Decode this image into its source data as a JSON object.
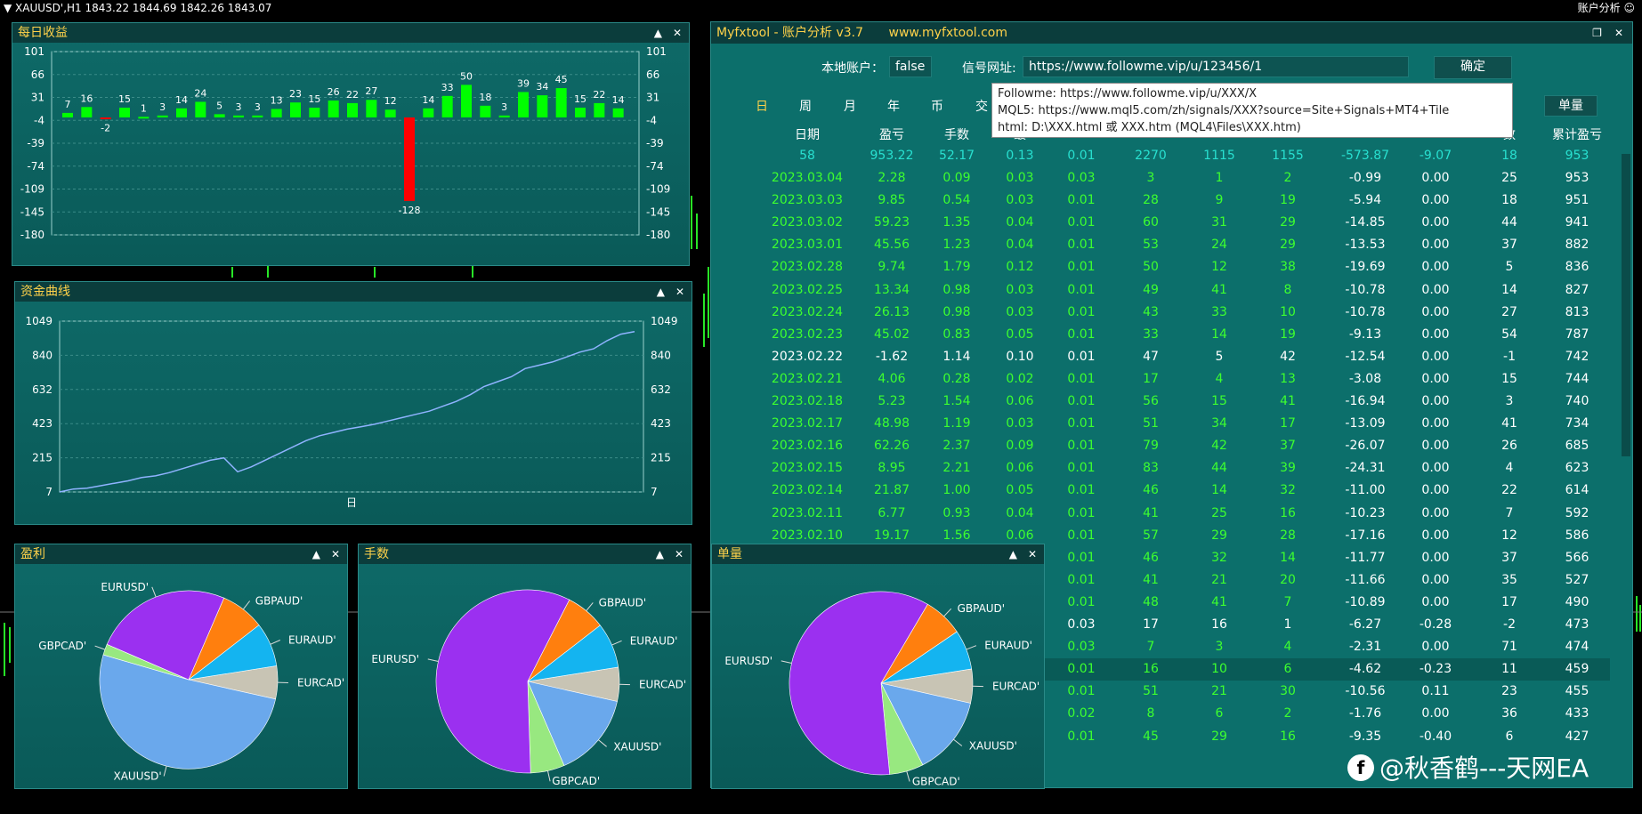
{
  "topbar": {
    "symbol_info": "▼ XAUUSD',H1  1843.22 1844.69 1842.26 1843.07",
    "right_label": "账户分析 ☺"
  },
  "daily": {
    "title": "每日收益",
    "y_ticks": [
      "101",
      "66",
      "31",
      "-4",
      "-39",
      "-74",
      "-109",
      "-145",
      "-180"
    ],
    "bars": [
      7,
      16,
      -2,
      15,
      1,
      3,
      14,
      24,
      5,
      3,
      3,
      13,
      23,
      15,
      26,
      22,
      27,
      12,
      -128,
      14,
      33,
      50,
      18,
      3,
      39,
      34,
      45,
      15,
      22,
      14
    ],
    "bar_labels": [
      "7",
      "16",
      "-2",
      "15",
      "1",
      "3",
      "14",
      "24",
      "5",
      "3",
      "3",
      "13",
      "23",
      "15",
      "26",
      "22",
      "27",
      "12",
      "-128",
      "14",
      "33",
      "50",
      "18",
      "3",
      "39",
      "34",
      "45",
      "15",
      "22",
      "14"
    ],
    "colors": {
      "positive": "#00ff00",
      "negative": "#ff0000"
    }
  },
  "equity": {
    "title": "资金曲线",
    "y_ticks": [
      "1049",
      "840",
      "632",
      "423",
      "215",
      "7"
    ],
    "x_label": "日",
    "line_color": "#8fb3ff"
  },
  "chart_data": [
    {
      "type": "bar",
      "title": "每日收益",
      "values": [
        7,
        16,
        -2,
        15,
        1,
        3,
        14,
        24,
        5,
        3,
        3,
        13,
        23,
        15,
        26,
        22,
        27,
        12,
        -128,
        14,
        33,
        50,
        18,
        3,
        39,
        34,
        45,
        15,
        22,
        14
      ],
      "ylim": [
        -180,
        101
      ]
    },
    {
      "type": "line",
      "title": "资金曲线",
      "xlabel": "日",
      "ylim": [
        7,
        1049
      ],
      "values": [
        7,
        25,
        30,
        45,
        60,
        75,
        95,
        105,
        125,
        150,
        175,
        200,
        215,
        130,
        160,
        200,
        240,
        280,
        320,
        350,
        370,
        390,
        405,
        420,
        440,
        460,
        480,
        500,
        530,
        560,
        600,
        650,
        680,
        710,
        760,
        780,
        800,
        830,
        860,
        880,
        930,
        970,
        985
      ]
    },
    {
      "type": "pie",
      "title": "盈利",
      "labels": [
        "EURUSD'",
        "GBPAUD'",
        "EURAUD'",
        "EURCAD'",
        "XAUUSD'",
        "GBPCAD'"
      ],
      "values": [
        25,
        8,
        8,
        6,
        51,
        2
      ]
    },
    {
      "type": "pie",
      "title": "手数",
      "labels": [
        "EURUSD'",
        "GBPAUD'",
        "EURAUD'",
        "EURCAD'",
        "XAUUSD'",
        "GBPCAD'"
      ],
      "values": [
        58,
        7,
        8,
        6,
        15,
        6
      ]
    },
    {
      "type": "pie",
      "title": "单量",
      "labels": [
        "EURUSD'",
        "GBPAUD'",
        "EURAUD'",
        "EURCAD'",
        "XAUUSD'",
        "GBPCAD'"
      ],
      "values": [
        60,
        7,
        7,
        6,
        14,
        6
      ]
    }
  ],
  "pies": [
    {
      "title": "盈利",
      "labels": [
        "EURUSD'",
        "GBPAUD'",
        "EURAUD'",
        "EURCAD'",
        "XAUUSD'",
        "GBPCAD'"
      ],
      "values": [
        25,
        8,
        8,
        6,
        51,
        2
      ],
      "colors": [
        "#9b30f0",
        "#ff7f0e",
        "#14b4f0",
        "#c8c4b4",
        "#6aa8ec",
        "#98e880"
      ]
    },
    {
      "title": "手数",
      "labels": [
        "EURUSD'",
        "GBPAUD'",
        "EURAUD'",
        "EURCAD'",
        "XAUUSD'",
        "GBPCAD'"
      ],
      "values": [
        58,
        7,
        8,
        6,
        15,
        6
      ],
      "colors": [
        "#9b30f0",
        "#ff7f0e",
        "#14b4f0",
        "#c8c4b4",
        "#6aa8ec",
        "#98e880"
      ]
    },
    {
      "title": "单量",
      "labels": [
        "EURUSD'",
        "GBPAUD'",
        "EURAUD'",
        "EURCAD'",
        "XAUUSD'",
        "GBPCAD'"
      ],
      "values": [
        60,
        7,
        7,
        6,
        14,
        6
      ],
      "colors": [
        "#9b30f0",
        "#ff7f0e",
        "#14b4f0",
        "#c8c4b4",
        "#6aa8ec",
        "#98e880"
      ]
    }
  ],
  "tool": {
    "title": "Myfxtool - 账户分析 v3.7",
    "site": "www.myfxtool.com",
    "local_label": "本地账户：",
    "local_value": "false",
    "signal_label": "信号网址:",
    "signal_value": "https://www.followme.vip/u/123456/1",
    "confirm": "确定",
    "periods": [
      "日",
      "周",
      "月",
      "年",
      "币",
      "交"
    ],
    "single_button": "单量",
    "tooltip": [
      "Followme:  https://www.followme.vip/u/XXX/X",
      "MQL5:  https://www.mql5.com/zh/signals/XXX?source=Site+Signals+MT4+Tile",
      "html:  D:\\XXX.html 或 XXX.htm (MQL4\\Files\\XXX.htm)"
    ],
    "headers": [
      "日期",
      "盈亏",
      "手数",
      "最",
      "",
      "",
      "",
      "",
      "",
      "",
      "数",
      "累计盈亏"
    ],
    "summary": [
      "58",
      "953.22",
      "52.17",
      "0.13",
      "0.01",
      "2270",
      "1115",
      "1155",
      "-573.87",
      "-9.07",
      "18",
      "953"
    ],
    "rows": [
      [
        "2023.03.04",
        "2.28",
        "0.09",
        "0.03",
        "0.03",
        "3",
        "1",
        "2",
        "-0.99",
        "0.00",
        "25",
        "953"
      ],
      [
        "2023.03.03",
        "9.85",
        "0.54",
        "0.03",
        "0.01",
        "28",
        "9",
        "19",
        "-5.94",
        "0.00",
        "18",
        "951"
      ],
      [
        "2023.03.02",
        "59.23",
        "1.35",
        "0.04",
        "0.01",
        "60",
        "31",
        "29",
        "-14.85",
        "0.00",
        "44",
        "941"
      ],
      [
        "2023.03.01",
        "45.56",
        "1.23",
        "0.04",
        "0.01",
        "53",
        "24",
        "29",
        "-13.53",
        "0.00",
        "37",
        "882"
      ],
      [
        "2023.02.28",
        "9.74",
        "1.79",
        "0.12",
        "0.01",
        "50",
        "12",
        "38",
        "-19.69",
        "0.00",
        "5",
        "836"
      ],
      [
        "2023.02.25",
        "13.34",
        "0.98",
        "0.03",
        "0.01",
        "49",
        "41",
        "8",
        "-10.78",
        "0.00",
        "14",
        "827"
      ],
      [
        "2023.02.24",
        "26.13",
        "0.98",
        "0.03",
        "0.01",
        "43",
        "33",
        "10",
        "-10.78",
        "0.00",
        "27",
        "813"
      ],
      [
        "2023.02.23",
        "45.02",
        "0.83",
        "0.05",
        "0.01",
        "33",
        "14",
        "19",
        "-9.13",
        "0.00",
        "54",
        "787"
      ],
      [
        "2023.02.22",
        "-1.62",
        "1.14",
        "0.10",
        "0.01",
        "47",
        "5",
        "42",
        "-12.54",
        "0.00",
        "-1",
        "742"
      ],
      [
        "2023.02.21",
        "4.06",
        "0.28",
        "0.02",
        "0.01",
        "17",
        "4",
        "13",
        "-3.08",
        "0.00",
        "15",
        "744"
      ],
      [
        "2023.02.18",
        "5.23",
        "1.54",
        "0.06",
        "0.01",
        "56",
        "15",
        "41",
        "-16.94",
        "0.00",
        "3",
        "740"
      ],
      [
        "2023.02.17",
        "48.98",
        "1.19",
        "0.03",
        "0.01",
        "51",
        "34",
        "17",
        "-13.09",
        "0.00",
        "41",
        "734"
      ],
      [
        "2023.02.16",
        "62.26",
        "2.37",
        "0.09",
        "0.01",
        "79",
        "42",
        "37",
        "-26.07",
        "0.00",
        "26",
        "685"
      ],
      [
        "2023.02.15",
        "8.95",
        "2.21",
        "0.06",
        "0.01",
        "83",
        "44",
        "39",
        "-24.31",
        "0.00",
        "4",
        "623"
      ],
      [
        "2023.02.14",
        "21.87",
        "1.00",
        "0.05",
        "0.01",
        "46",
        "14",
        "32",
        "-11.00",
        "0.00",
        "22",
        "614"
      ],
      [
        "2023.02.11",
        "6.77",
        "0.93",
        "0.04",
        "0.01",
        "41",
        "25",
        "16",
        "-10.23",
        "0.00",
        "7",
        "592"
      ],
      [
        "2023.02.10",
        "19.17",
        "1.56",
        "0.06",
        "0.01",
        "57",
        "29",
        "28",
        "-17.16",
        "0.00",
        "12",
        "586"
      ],
      [
        "",
        "",
        "",
        "",
        "0.01",
        "46",
        "32",
        "14",
        "-11.77",
        "0.00",
        "37",
        "566"
      ],
      [
        "",
        "",
        "",
        "",
        "0.01",
        "41",
        "21",
        "20",
        "-11.66",
        "0.00",
        "35",
        "527"
      ],
      [
        "",
        "",
        "",
        "",
        "0.01",
        "48",
        "41",
        "7",
        "-10.89",
        "0.00",
        "17",
        "490"
      ],
      [
        "",
        "",
        "",
        "",
        "0.03",
        "17",
        "16",
        "1",
        "-6.27",
        "-0.28",
        "-2",
        "473"
      ],
      [
        "",
        "",
        "",
        "",
        "0.03",
        "7",
        "3",
        "4",
        "-2.31",
        "0.00",
        "71",
        "474"
      ],
      [
        "",
        "",
        "",
        "",
        "0.01",
        "16",
        "10",
        "6",
        "-4.62",
        "-0.23",
        "11",
        "459"
      ],
      [
        "",
        "",
        "",
        "",
        "0.01",
        "51",
        "21",
        "30",
        "-10.56",
        "0.11",
        "23",
        "455"
      ],
      [
        "",
        "",
        "",
        "",
        "0.02",
        "8",
        "6",
        "2",
        "-1.76",
        "0.00",
        "36",
        "433"
      ],
      [
        "",
        "",
        "",
        "",
        "0.01",
        "45",
        "29",
        "16",
        "-9.35",
        "-0.40",
        "6",
        "427"
      ]
    ]
  },
  "watermark": "@秋香鹤---天网EA"
}
